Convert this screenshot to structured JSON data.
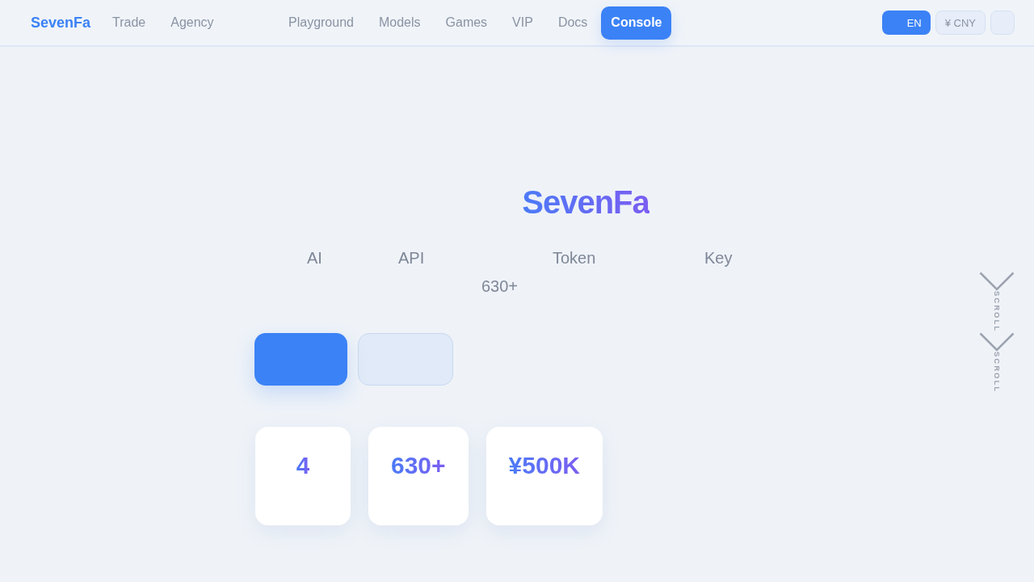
{
  "nav": {
    "logo": "SevenFa",
    "left_links": [
      "Trade",
      "Agency"
    ],
    "center_links": [
      "Playground",
      "Models",
      "Games",
      "VIP",
      "Docs"
    ],
    "cta": "Console",
    "language": "EN",
    "currency": "¥ CNY"
  },
  "hero": {
    "title": "SevenFa",
    "keywords": [
      "AI",
      "API",
      "Token",
      "Key"
    ],
    "count": "630+",
    "buttons": [
      {
        "kind": "primary"
      },
      {
        "kind": "secondary"
      }
    ],
    "stats": [
      {
        "value": "4"
      },
      {
        "value": "630+"
      },
      {
        "value": "¥500K"
      }
    ]
  },
  "scroll_hint": {
    "labels": [
      "SCROLL",
      "SCROLL"
    ]
  }
}
